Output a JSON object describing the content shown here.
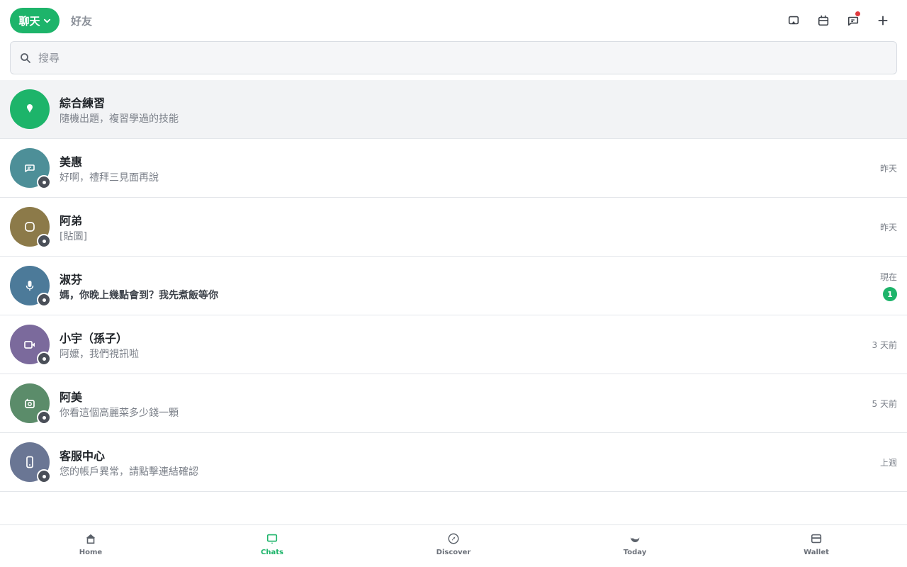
{
  "colors": {
    "accent": "#1db46a",
    "notification": "#e0393e",
    "muted": "#8a8f98"
  },
  "header": {
    "chat_tab_label": "聊天",
    "friends_tab_label": "好友",
    "icons": [
      "cast-icon",
      "calendar-icon",
      "message-icon",
      "plus-icon"
    ]
  },
  "search": {
    "placeholder": "搜尋",
    "value": ""
  },
  "chats": [
    {
      "name": "綜合練習",
      "preview": "隨機出題，複習學過的技能",
      "time": "",
      "unread": 0,
      "avatar_color": "#1db46a",
      "icon": "pin-icon",
      "highlight": true
    },
    {
      "name": "美惠",
      "preview": "好啊，禮拜三見面再說",
      "time": "昨天",
      "unread": 0,
      "avatar_color": "#4d8f98",
      "icon": "message-icon"
    },
    {
      "name": "阿弟",
      "preview": "[貼圖]",
      "time": "昨天",
      "unread": 0,
      "avatar_color": "#8c7a49",
      "icon": "sticker-icon"
    },
    {
      "name": "淑芬",
      "preview": "媽，你晚上幾點會到？我先煮飯等你",
      "time": "現在",
      "unread": 1,
      "avatar_color": "#4c7a99",
      "icon": "microphone-icon"
    },
    {
      "name": "小宇（孫子）",
      "preview": "阿嬤，我們視訊啦",
      "time": "3 天前",
      "unread": 0,
      "avatar_color": "#7b6a9c",
      "icon": "video-icon"
    },
    {
      "name": "阿美",
      "preview": "你看這個高麗菜多少錢一顆",
      "time": "5 天前",
      "unread": 0,
      "avatar_color": "#5b8c6a",
      "icon": "camera-icon"
    },
    {
      "name": "客服中心",
      "preview": "您的帳戶異常，請點擊連結確認",
      "time": "上週",
      "unread": 0,
      "avatar_color": "#6a7694",
      "icon": "phone-icon"
    }
  ],
  "nav": [
    {
      "label": "Home",
      "icon": "home-icon",
      "active": false
    },
    {
      "label": "Chats",
      "icon": "chat-icon",
      "active": true
    },
    {
      "label": "Discover",
      "icon": "compass-icon",
      "active": false
    },
    {
      "label": "Today",
      "icon": "moon-icon",
      "active": false
    },
    {
      "label": "Wallet",
      "icon": "wallet-icon",
      "active": false
    }
  ]
}
